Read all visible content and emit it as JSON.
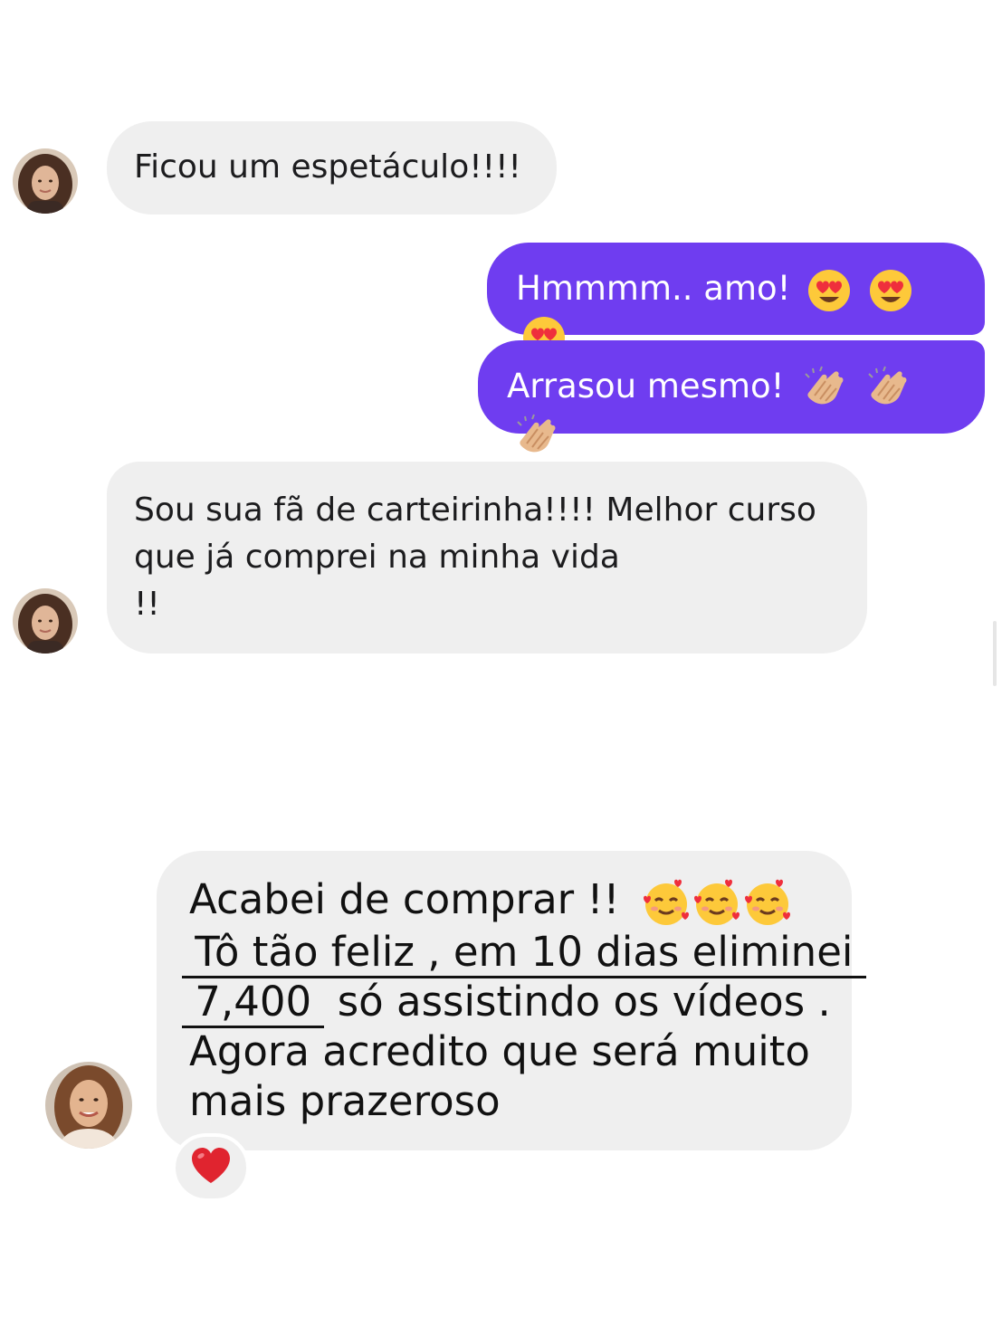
{
  "messages": [
    {
      "id": "m1",
      "direction": "incoming",
      "text": "Ficou um espetáculo!!!!"
    },
    {
      "id": "m2",
      "direction": "outgoing",
      "text": "Hmmmm.. amo!",
      "emoji": [
        "smiling-face-with-heart-eyes",
        "smiling-face-with-heart-eyes",
        "smiling-face-with-heart-eyes"
      ]
    },
    {
      "id": "m3",
      "direction": "outgoing",
      "text": "Arrasou mesmo!",
      "emoji": [
        "clapping-hands",
        "clapping-hands",
        "clapping-hands"
      ]
    },
    {
      "id": "m4",
      "direction": "incoming",
      "lines": [
        "Sou sua fã de carteirinha!!!! Melhor curso",
        "que já comprei na minha vida",
        "!!"
      ]
    },
    {
      "id": "m5",
      "direction": "incoming",
      "line1": "Acabei de comprar !!",
      "line1_emoji": [
        "smiling-face-with-hearts",
        "smiling-face-with-hearts",
        "smiling-face-with-hearts"
      ],
      "line2_underlined": " Tô tão feliz , em 10 dias eliminei ",
      "line3_underlined": " 7,400 ",
      "line3_rest": " só assistindo os vídeos .",
      "line4": "Agora acredito que será muito",
      "line5": "mais prazeroso",
      "reaction": "red-heart"
    }
  ],
  "colors": {
    "incoming_bubble": "#efefef",
    "outgoing_bubble": "#6f3df0",
    "outgoing_text": "#ffffff",
    "incoming_text": "#1c1c1e",
    "reaction_heart": "#e0242f"
  }
}
